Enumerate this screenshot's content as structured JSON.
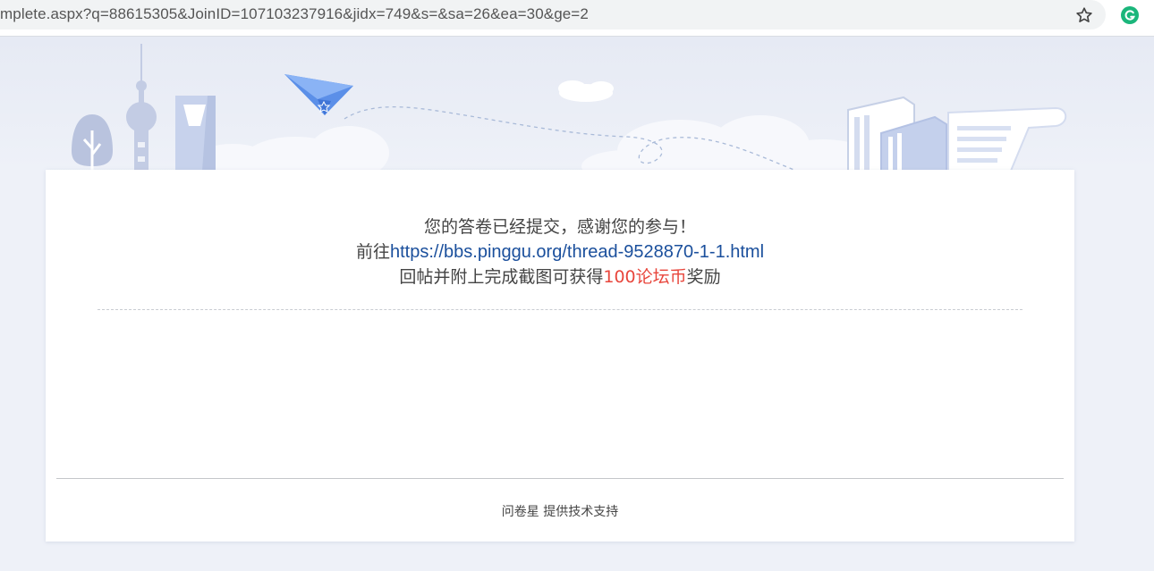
{
  "browser": {
    "url": "mplete.aspx?q=88615305&JoinID=107103237916&jidx=749&s=&sa=26&ea=30&ge=2",
    "accent": "#1bb67b"
  },
  "icons": [
    "star-icon",
    "grammarly-icon",
    "tv-tower-icon",
    "tree-icon",
    "tower-building-icon",
    "paper-plane-icon",
    "cloud-icon",
    "books-icon",
    "scroll-paper-icon"
  ],
  "message": {
    "line1": "您的答卷已经提交，感谢您的参与！",
    "line2_prefix": "前往",
    "link": "https://bbs.pinggu.org/thread-9528870-1-1.html",
    "line3_prefix": "回帖并附上完成截图可获得",
    "reward": "100论坛币",
    "line3_suffix": "奖励",
    "reward_color": "#e8463c",
    "link_color": "#1a4f9c"
  },
  "footer": {
    "brand": "问卷星",
    "text": " 提供技术支持"
  }
}
